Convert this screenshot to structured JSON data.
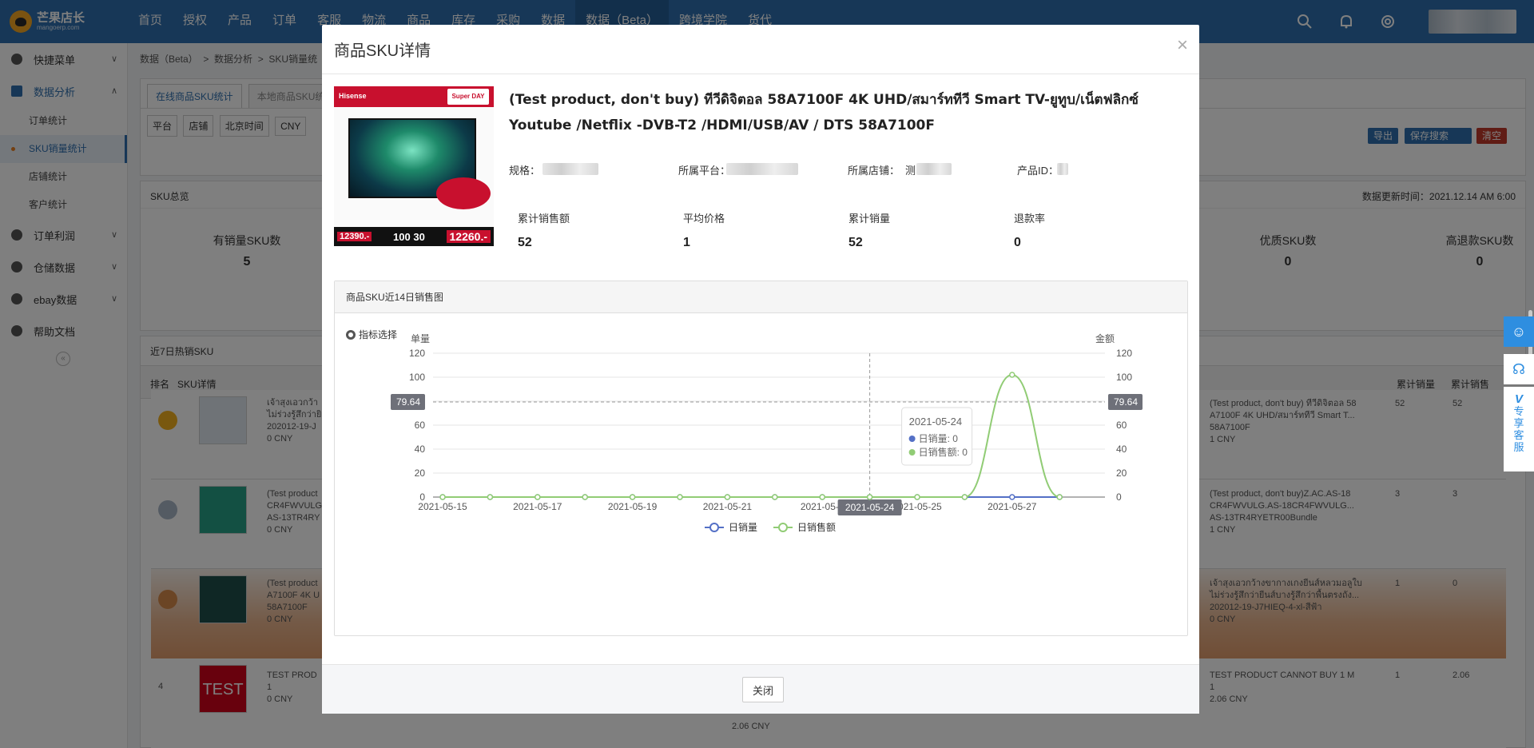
{
  "brand": {
    "name": "芒果店长",
    "sub": "mangoerp.com"
  },
  "nav": [
    "首页",
    "授权",
    "产品",
    "订单",
    "客服",
    "物流",
    "商品",
    "库存",
    "采购",
    "数据",
    "数据（Beta）",
    "跨境学院",
    "货代"
  ],
  "sidebar": {
    "quick_menu": "快捷菜单",
    "data_analysis": "数据分析",
    "subs": [
      "订单统计",
      "SKU销量统计",
      "店铺统计",
      "客户统计"
    ],
    "groups": [
      "订单利润",
      "仓储数据",
      "ebay数据",
      "帮助文档"
    ]
  },
  "background": {
    "breadcrumb": [
      "数据（Beta）",
      "数据分析",
      "SKU销量统"
    ],
    "tabs": [
      "在线商品SKU统计",
      "本地商品SKU统"
    ],
    "filters": [
      "平台",
      "店铺",
      "北京时间",
      "CNY"
    ],
    "actions": [
      "导出",
      "保存搜索",
      "清空"
    ],
    "sku_overview": "SKU总览",
    "update_time": "数据更新时间：2021.12.14 AM 6:00",
    "stats": [
      {
        "label": "有销量SKU数",
        "value": "5"
      },
      {
        "label": "优质SKU数",
        "value": "0"
      },
      {
        "label": "高退款SKU数",
        "value": "0"
      }
    ],
    "hot_title": "近7日热销SKU",
    "table_headers": [
      "排名",
      "SKU详情",
      "累计销量",
      "累计销售"
    ],
    "rows": [
      {
        "left": [
          "เจ้าสุงเอวกว้า",
          "ไม่ร่วงรู้สึกว่ายิ",
          "202012-19-J",
          "0 CNY"
        ],
        "right": [
          "(Test product, don't buy) ทีวีดิจิตอล 58",
          "A7100F 4K UHD/สมาร์ททีวี Smart T...",
          "58A7100F",
          "1 CNY"
        ],
        "qty": "52",
        "amt": "52"
      },
      {
        "left": [
          "(Test product",
          "CR4FWVULG",
          "AS-13TR4RY",
          "0 CNY"
        ],
        "right": [
          "(Test product, don't buy)Z.AC.AS-18",
          "CR4FWVULG.AS-18CR4FWVULG...",
          "AS-13TR4RYETR00Bundle",
          "1 CNY"
        ],
        "qty": "3",
        "amt": "3"
      },
      {
        "left": [
          "(Test product",
          "A7100F 4K U",
          "58A7100F",
          "0 CNY"
        ],
        "right": [
          "เจ้าสุงเอวกว้างขากางเกงยีนส์หลวมอลูใบ",
          "ไม่ร่วงรู้สึกว่ายีนส์บางรู้สึกว่าพื้นตรงถัง...",
          "202012-19-J7HIEQ-4-xl-สีฟ้า",
          "0 CNY"
        ],
        "qty": "1",
        "amt": "0"
      },
      {
        "left": [
          "TEST PROD",
          "",
          "1",
          "0 CNY"
        ],
        "right": [
          "TEST PRODUCT CANNOT BUY 1 M",
          "",
          "1",
          "2.06 CNY"
        ],
        "qty": "1",
        "amt": "2.06",
        "num": "4",
        "mid": "2.06 CNY",
        "thumb": "TEST"
      }
    ]
  },
  "float": {
    "vip": [
      "专",
      "享",
      "客",
      "服"
    ]
  },
  "modal": {
    "title": "商品SKU详情",
    "close_x": "×",
    "product_title": "(Test product, don't buy) ทีวีดิจิตอล 58A7100F 4K UHD/สมาร์ททีวี Smart TV-ยูทูบ/เน็ตฟลิกซ์ Youtube /Netflix -DVB-T2 /HDMI/USB/AV / DTS 58A7100F",
    "image_text": {
      "brand": "Hisense",
      "badge": "Super DAY",
      "old_price": "12390.-",
      "mid": "100 30",
      "new_price": "12260.-"
    },
    "meta": {
      "spec": "规格：",
      "platform": "所属平台：",
      "shop": "所属店铺：",
      "shop_initial": "测",
      "product_id": "产品ID："
    },
    "kpis": [
      {
        "label": "累计销售额",
        "value": "52"
      },
      {
        "label": "平均价格",
        "value": "1"
      },
      {
        "label": "累计销量",
        "value": "52"
      },
      {
        "label": "退款率",
        "value": "0"
      }
    ],
    "chart_panel_title": "商品SKU近14日销售图",
    "metric_select": "指标选择",
    "close_button": "关闭"
  },
  "chart_data": {
    "type": "line",
    "title": "商品SKU近14日销售图",
    "ylabel_left": "单量",
    "ylabel_right": "金额",
    "x": [
      "2021-05-15",
      "2021-05-16",
      "2021-05-17",
      "2021-05-18",
      "2021-05-19",
      "2021-05-20",
      "2021-05-21",
      "2021-05-22",
      "2021-05-23",
      "2021-05-24",
      "2021-05-25",
      "2021-05-26",
      "2021-05-27",
      "2021-05-28"
    ],
    "x_tick_labels": [
      "2021-05-15",
      "2021-05-17",
      "2021-05-19",
      "2021-05-21",
      "2021-05-2",
      "2021-05-25",
      "2021-05-27"
    ],
    "ylim_left": [
      0,
      120
    ],
    "ylim_right": [
      0,
      120
    ],
    "yticks": [
      0,
      20,
      40,
      60,
      80,
      100,
      120
    ],
    "series": [
      {
        "name": "日销量",
        "color": "#5470c6",
        "axis": "left",
        "values": [
          0,
          0,
          0,
          0,
          0,
          0,
          0,
          0,
          0,
          0,
          0,
          0,
          0,
          0
        ]
      },
      {
        "name": "日销售额",
        "color": "#91cc75",
        "axis": "right",
        "values": [
          0,
          0,
          0,
          0,
          0,
          0,
          0,
          0,
          0,
          0,
          0,
          0,
          102,
          0
        ]
      }
    ],
    "crosshair": {
      "x": "2021-05-24",
      "y_left_label": "79.64",
      "y_right_label": "79.64"
    },
    "tooltip": {
      "title": "2021-05-24",
      "lines": [
        "日销量: 0",
        "日销售额: 0"
      ]
    },
    "legend": "bottom-center",
    "grid": true
  }
}
